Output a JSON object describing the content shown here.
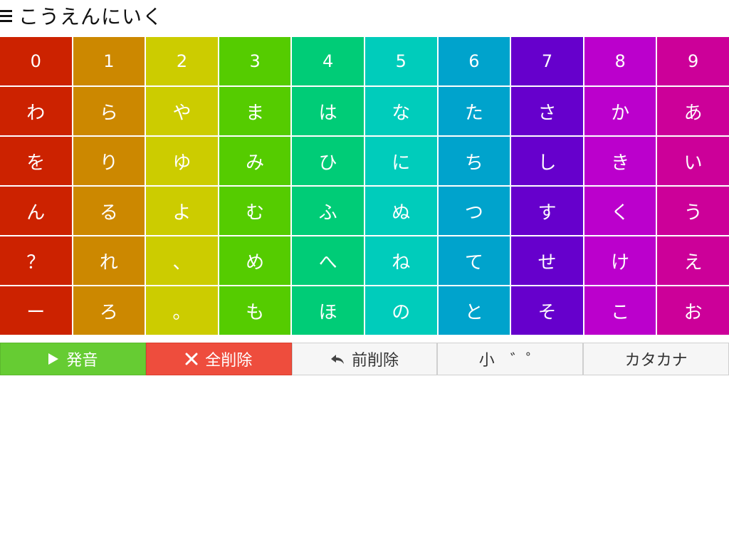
{
  "header": {
    "menu_icon": "hamburger-menu-icon",
    "text": "こうえんにいく"
  },
  "grid": {
    "columns": [
      {
        "color": "#cc2200",
        "keys": [
          "0",
          "わ",
          "を",
          "ん",
          "？",
          "ー"
        ]
      },
      {
        "color": "#cc8800",
        "keys": [
          "1",
          "ら",
          "り",
          "る",
          "れ",
          "ろ"
        ]
      },
      {
        "color": "#cccc00",
        "keys": [
          "2",
          "や",
          "ゆ",
          "よ",
          "、",
          "。"
        ]
      },
      {
        "color": "#55cc00",
        "keys": [
          "3",
          "ま",
          "み",
          "む",
          "め",
          "も"
        ]
      },
      {
        "color": "#00cc77",
        "keys": [
          "4",
          "は",
          "ひ",
          "ふ",
          "へ",
          "ほ"
        ]
      },
      {
        "color": "#00ccbb",
        "keys": [
          "5",
          "な",
          "に",
          "ぬ",
          "ね",
          "の"
        ]
      },
      {
        "color": "#00a3cc",
        "keys": [
          "6",
          "た",
          "ち",
          "つ",
          "て",
          "と"
        ]
      },
      {
        "color": "#6600cc",
        "keys": [
          "7",
          "さ",
          "し",
          "す",
          "せ",
          "そ"
        ]
      },
      {
        "color": "#bb00cc",
        "keys": [
          "8",
          "か",
          "き",
          "く",
          "け",
          "こ"
        ]
      },
      {
        "color": "#cc0099",
        "keys": [
          "9",
          "あ",
          "い",
          "う",
          "え",
          "お"
        ]
      }
    ]
  },
  "toolbar": {
    "speak": {
      "label": "発音",
      "icon": "play-icon",
      "color": "#66cc33"
    },
    "clear_all": {
      "label": "全削除",
      "icon": "close-icon",
      "color": "#ee4d3d"
    },
    "backspace": {
      "label": "前削除",
      "icon": "reply-arrow-icon"
    },
    "small_dakuten": {
      "label": "小　゛゜"
    },
    "katakana": {
      "label": "カタカナ"
    }
  }
}
